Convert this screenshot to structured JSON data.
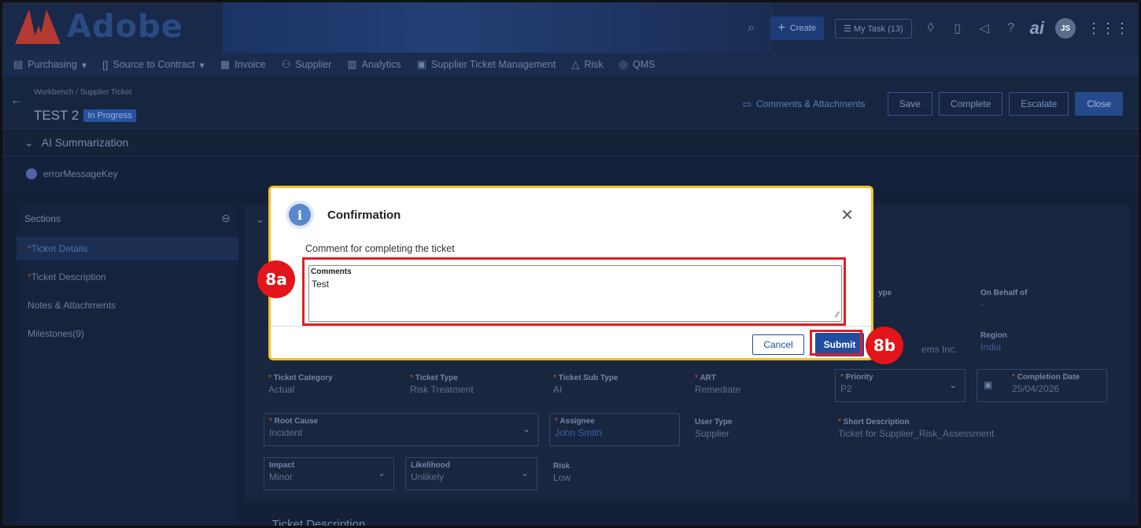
{
  "header": {
    "brand": "Adobe",
    "create_label": "Create",
    "my_task_label": "My Task (13)",
    "ai_mark": "ai",
    "avatar_initials": "JS"
  },
  "nav": {
    "items": [
      {
        "label": "Purchasing",
        "icon": "document-icon",
        "has_caret": true
      },
      {
        "label": "Source to Contract",
        "icon": "bracket-icon",
        "has_caret": true
      },
      {
        "label": "Invoice",
        "icon": "invoice-icon",
        "has_caret": false
      },
      {
        "label": "Supplier",
        "icon": "supplier-icon",
        "has_caret": false
      },
      {
        "label": "Analytics",
        "icon": "analytics-icon",
        "has_caret": false
      },
      {
        "label": "Supplier Ticket Management",
        "icon": "ticket-icon",
        "has_caret": false
      },
      {
        "label": "Risk",
        "icon": "warning-icon",
        "has_caret": false
      },
      {
        "label": "QMS",
        "icon": "qms-icon",
        "has_caret": false
      }
    ]
  },
  "page": {
    "breadcrumb": "Workbench / Supplier Ticket",
    "title": "TEST 2",
    "status": "In Progress",
    "comments_link": "Comments & Attachments",
    "actions": {
      "save": "Save",
      "complete": "Complete",
      "escalate": "Escalate",
      "close": "Close"
    },
    "ai_summarization": "AI Summarization",
    "error_key": "errorMessageKey"
  },
  "sidebar": {
    "title": "Sections",
    "items": [
      {
        "label": "Ticket Details",
        "required": true,
        "active": true
      },
      {
        "label": "Ticket Description",
        "required": true,
        "active": false
      },
      {
        "label": "Notes & Attachments",
        "required": false,
        "active": false
      },
      {
        "label": "Milestones(9)",
        "required": false,
        "active": false
      }
    ]
  },
  "details": {
    "type_label_partial": "ype",
    "on_behalf_label": "On Behalf of",
    "on_behalf_value": "-",
    "supplier_partial": "ems Inc.",
    "region_label": "Region",
    "region_value": "India",
    "ticket_category_label": "Ticket Category",
    "ticket_category_value": "Actual",
    "ticket_type_label": "Ticket Type",
    "ticket_type_value": "Risk Treatment",
    "ticket_subtype_label": "Ticket Sub Type",
    "ticket_subtype_value": "AI",
    "art_label": "ART",
    "art_value": "Remediate",
    "priority_label": "Priority",
    "priority_value": "P2",
    "completion_date_label": "Completion Date",
    "completion_date_value": "25/04/2026",
    "root_cause_label": "Root Cause",
    "root_cause_value": "Incident",
    "assignee_label": "Assignee",
    "assignee_value": "John Smith",
    "user_type_label": "User Type",
    "user_type_value": "Supplier",
    "short_desc_label": "Short Description",
    "short_desc_value": "Ticket for Supplier_Risk_Assessment",
    "impact_label": "Impact",
    "impact_value": "Minor",
    "likelihood_label": "Likelihood",
    "likelihood_value": "Unlikely",
    "risk_label": "Risk",
    "risk_value": "Low",
    "ticket_description_section": "Ticket Description"
  },
  "modal": {
    "title": "Confirmation",
    "description": "Comment for completing the ticket",
    "comments_label": "Comments",
    "comments_value": "Test",
    "cancel_label": "Cancel",
    "submit_label": "Submit"
  },
  "annotations": {
    "step_a": "8a",
    "step_b": "8b",
    "color": "#e3151b"
  }
}
